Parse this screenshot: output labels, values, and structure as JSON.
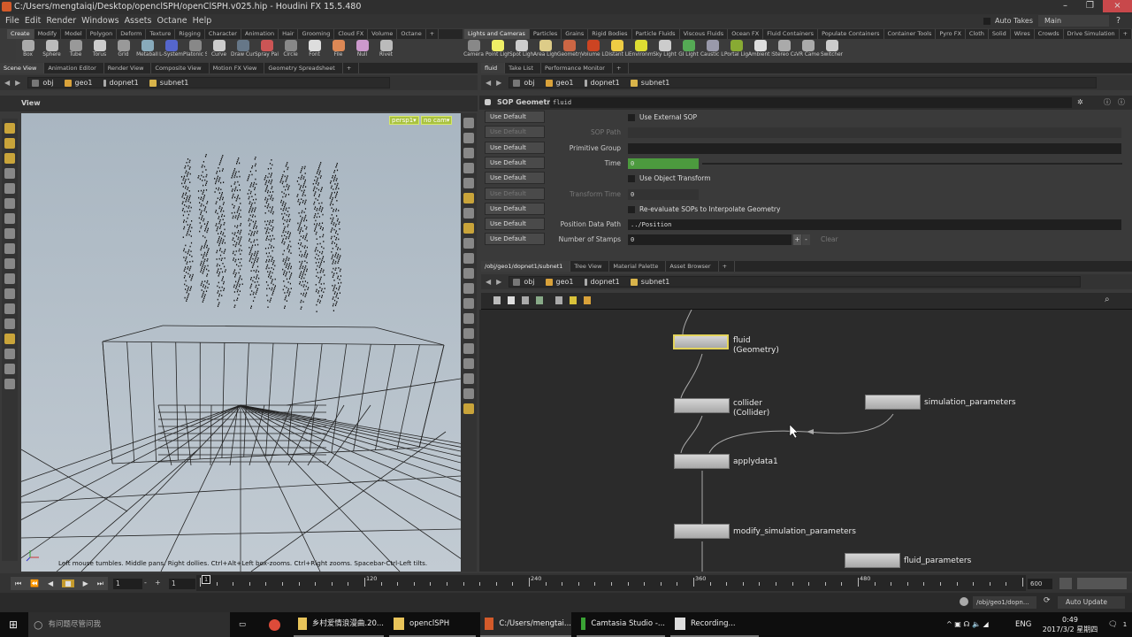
{
  "window": {
    "title": "C:/Users/mengtaiqi/Desktop/openclSPH/openClSPH.v025.hip - Houdini FX 15.5.480",
    "minimize": "–",
    "restore": "❐",
    "close": "×"
  },
  "menu": [
    "File",
    "Edit",
    "Render",
    "Windows",
    "Assets",
    "Octane",
    "Help"
  ],
  "top_right": {
    "auto_takes": "Auto Takes",
    "desktop": "Main",
    "help": "?"
  },
  "shelf_left": {
    "tabs": [
      "Create",
      "Modify",
      "Model",
      "Polygon",
      "Deform",
      "Texture",
      "Rigging",
      "Character",
      "Animation",
      "Hair",
      "Grooming",
      "Cloud FX",
      "Volume",
      "Octane",
      "+"
    ],
    "tools": [
      "Box",
      "Sphere",
      "Tube",
      "Torus",
      "Grid",
      "Metaball",
      "L-System",
      "Platonic Sol...",
      "Curve",
      "Draw Curve",
      "Spray Paint",
      "Circle",
      "Font",
      "File",
      "Null",
      "Rivet"
    ]
  },
  "shelf_right": {
    "tabs": [
      "Lights and Cameras",
      "Particles",
      "Grains",
      "Rigid Bodies",
      "Particle Fluids",
      "Viscous Fluids",
      "Ocean FX",
      "Fluid Containers",
      "Populate Containers",
      "Container Tools",
      "Pyro FX",
      "Cloth",
      "Solid",
      "Wires",
      "Crowds",
      "Drive Simulation",
      "+"
    ],
    "tools": [
      "Camera",
      "Point Light",
      "Spot Light",
      "Area Light",
      "Geometry L...",
      "Volume Light",
      "Distant Light",
      "Environmen...",
      "Sky Light",
      "GI Light",
      "Caustic Light",
      "Portal Light",
      "Ambient Lig...",
      "Stereo Cam...",
      "VR Camera",
      "Switcher"
    ]
  },
  "left_pane_tabs": [
    "Scene View",
    "Animation Editor",
    "Render View",
    "Composite View",
    "Motion FX View",
    "Geometry Spreadsheet",
    "+"
  ],
  "right_pane_tabs": [
    "fluid",
    "Take List",
    "Performance Monitor",
    "+"
  ],
  "path": [
    "obj",
    "geo1",
    "dopnet1",
    "subnet1"
  ],
  "viewer": {
    "title": "View",
    "camera": "persp1▾",
    "cam_menu": "no cam▾",
    "hint": "Left mouse tumbles. Middle pans. Right dollies. Ctrl+Alt+Left box-zooms. Ctrl+Right zooms. Spacebar-Ctrl-Left tilts."
  },
  "params": {
    "node_type": "SOP Geometry",
    "node_name": "fluid",
    "use_default": "Use Default",
    "rows": [
      {
        "kind": "check",
        "label": "Use External SOP"
      },
      {
        "kind": "field",
        "label": "SOP Path",
        "value": "",
        "dim": true
      },
      {
        "kind": "field",
        "label": "Primitive Group",
        "value": ""
      },
      {
        "kind": "slider",
        "label": "Time",
        "value": "0"
      },
      {
        "kind": "check",
        "label": "Use Object Transform"
      },
      {
        "kind": "field",
        "label": "Transform Time",
        "value": "0",
        "dim": true
      },
      {
        "kind": "check",
        "label": "Re-evaluate SOPs to Interpolate Geometry"
      },
      {
        "kind": "field",
        "label": "Position Data Path",
        "value": "../Position"
      },
      {
        "kind": "stamps",
        "label": "Number of Stamps",
        "value": "0",
        "plus": "+",
        "minus": "-",
        "clear": "Clear"
      }
    ]
  },
  "network_tabs": [
    "/obj/geo1/dopnet1/subnet1",
    "Tree View",
    "Material Palette",
    "Asset Browser",
    "+"
  ],
  "nodes": [
    {
      "name": "fluid",
      "sub": "(Geometry)"
    },
    {
      "name": "collider",
      "sub": "(Collider)"
    },
    {
      "name": "simulation_parameters",
      "sub": ""
    },
    {
      "name": "applydata1",
      "sub": ""
    },
    {
      "name": "modify_simulation_parameters",
      "sub": ""
    },
    {
      "name": "fluid_parameters",
      "sub": ""
    }
  ],
  "timeline": {
    "frame": "1",
    "start": "1",
    "ticks": [
      "1",
      "120",
      "240",
      "360",
      "480"
    ],
    "end": "600",
    "minus": "-",
    "plus": "+"
  },
  "status": {
    "path": "/obj/geo1/dopn...",
    "update": "Auto Update"
  },
  "taskbar": {
    "search": "有问题尽管问我",
    "items": [
      "乡村爱情浪漫曲.20...",
      "openclSPH",
      "C:/Users/mengtai...",
      "Camtasia Studio -...",
      "Recording..."
    ],
    "lang": "ENG",
    "time": "0:49",
    "date": "2017/3/2 星期四",
    "notif": "1"
  }
}
